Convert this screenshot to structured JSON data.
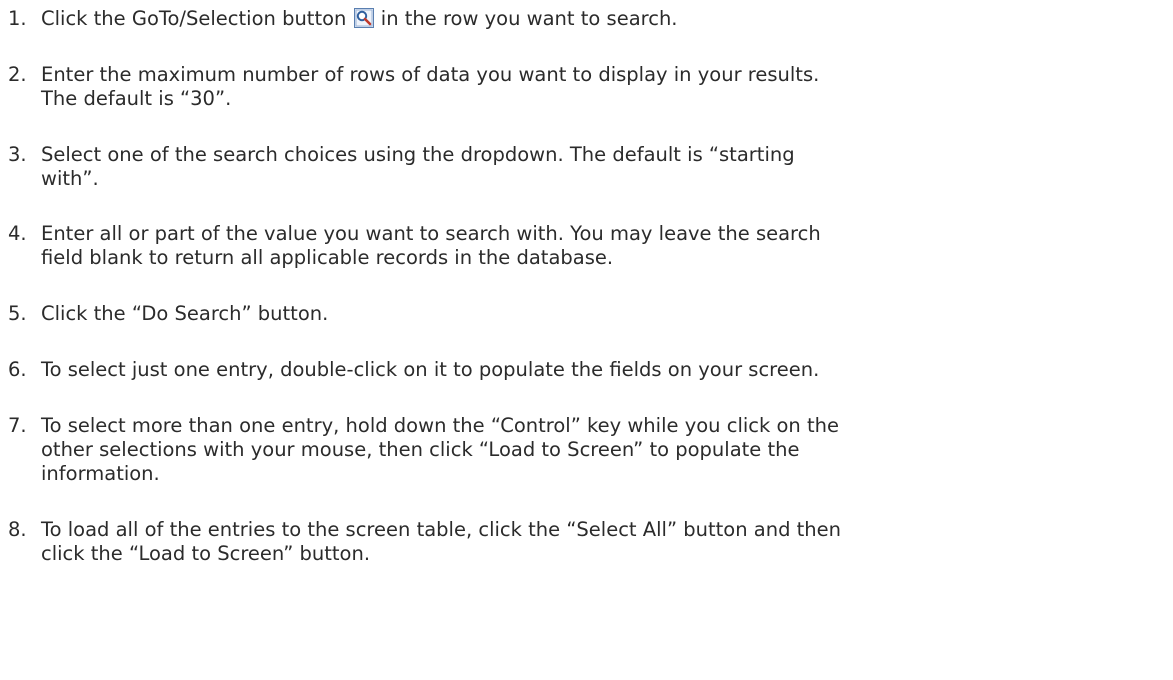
{
  "steps": [
    {
      "number": "1.",
      "lines": [
        {
          "before_icon": "Click the GoTo/Selection button ",
          "after_icon": " in the row you want to search."
        }
      ],
      "icon": "goto-selection-magnifier-icon"
    },
    {
      "number": "2.",
      "lines": [
        "Enter the maximum number of rows of data you want to display in your results.",
        "The default is “30”."
      ]
    },
    {
      "number": "3.",
      "lines": [
        "Select one of the search choices using the dropdown.  The default is “starting",
        "with”."
      ]
    },
    {
      "number": "4.",
      "lines": [
        "Enter all or part of the value you want to search with.  You may leave the search",
        "field blank to return all applicable records in the database."
      ]
    },
    {
      "number": "5.",
      "lines": [
        "Click the “Do Search” button."
      ]
    },
    {
      "number": "6.",
      "lines": [
        "To select just one entry, double-click on it to populate the fields on your screen."
      ]
    },
    {
      "number": "7.",
      "lines": [
        "To select more than one entry, hold down the “Control” key while you click on the",
        "other selections with your mouse, then click “Load to Screen” to populate the",
        "information."
      ]
    },
    {
      "number": "8.",
      "lines": [
        "To load all of the entries to the screen table, click the “Select All” button and then",
        "click the “Load to Screen” button."
      ]
    }
  ],
  "colors": {
    "text": "#2b2b2b",
    "icon_frame": "#5a7fb0",
    "icon_bg": "#dfe9f7",
    "icon_lens": "#2f5f9e",
    "icon_handle": "#c0392b"
  }
}
